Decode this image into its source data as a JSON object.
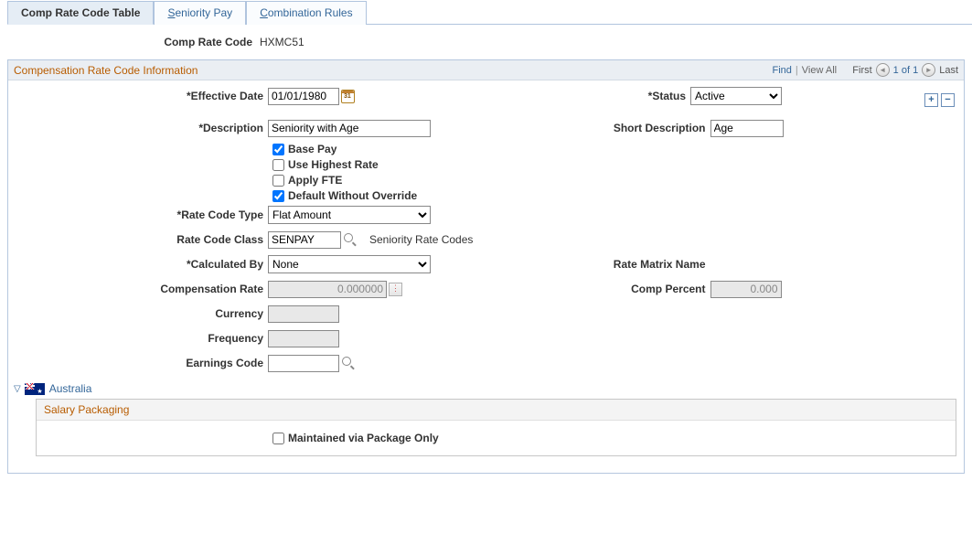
{
  "tabs": [
    {
      "label": "Comp Rate Code Table",
      "active": true
    },
    {
      "label_pre": "S",
      "label_rest": "eniority Pay",
      "active": false
    },
    {
      "label_pre": "C",
      "label_rest": "ombination Rules",
      "active": false
    }
  ],
  "header": {
    "label": "Comp Rate Code",
    "value": "HXMC51"
  },
  "section": {
    "title": "Compensation Rate Code Information",
    "nav": {
      "find": "Find",
      "viewall": "View All",
      "first": "First",
      "counter": "1 of 1",
      "last": "Last"
    }
  },
  "form": {
    "eff_date": {
      "label": "Effective Date",
      "value": "01/01/1980"
    },
    "status": {
      "label": "Status",
      "value": "Active"
    },
    "description": {
      "label": "Description",
      "value": "Seniority with Age"
    },
    "short_desc": {
      "label": "Short Description",
      "value": "Age"
    },
    "chk_base_pay": {
      "label": "Base Pay",
      "checked": true
    },
    "chk_highest": {
      "label": "Use Highest Rate",
      "checked": false
    },
    "chk_fte": {
      "label": "Apply FTE",
      "checked": false
    },
    "chk_default": {
      "label": "Default Without Override",
      "checked": true
    },
    "rate_code_type": {
      "label": "Rate Code Type",
      "value": "Flat Amount"
    },
    "rate_code_class": {
      "label": "Rate Code Class",
      "value": "SENPAY",
      "desc": "Seniority Rate Codes"
    },
    "calculated_by": {
      "label": "Calculated By",
      "value": "None"
    },
    "rate_matrix": {
      "label": "Rate Matrix Name"
    },
    "comp_rate": {
      "label": "Compensation Rate",
      "value": "0.000000"
    },
    "comp_percent": {
      "label": "Comp Percent",
      "value": "0.000"
    },
    "currency": {
      "label": "Currency",
      "value": ""
    },
    "frequency": {
      "label": "Frequency",
      "value": ""
    },
    "earnings": {
      "label": "Earnings Code",
      "value": ""
    }
  },
  "australia": {
    "title": "Australia",
    "sub_title": "Salary Packaging",
    "maintained": {
      "label": "Maintained via Package Only",
      "checked": false
    }
  }
}
